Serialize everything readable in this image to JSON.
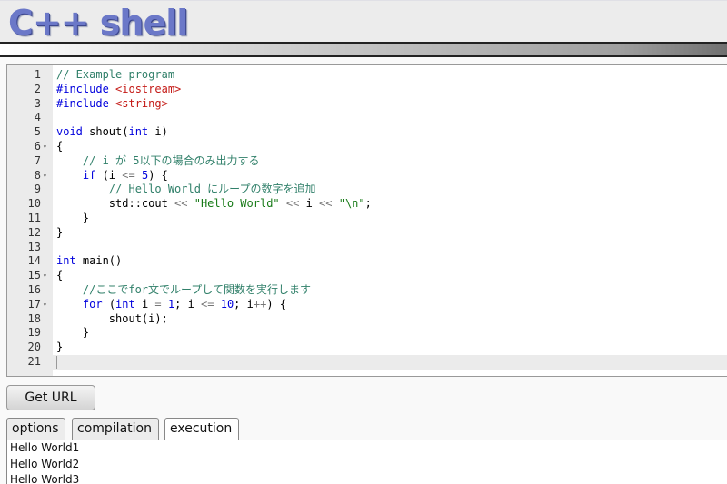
{
  "header": {
    "logo_text": "C++ shell"
  },
  "editor": {
    "lines": [
      {
        "n": "1",
        "fold": "",
        "html": "<span class='cm'>// Example program</span>"
      },
      {
        "n": "2",
        "fold": "",
        "html": "<span class='kw'>#include</span> <span class='inc'>&lt;iostream&gt;</span>"
      },
      {
        "n": "3",
        "fold": "",
        "html": "<span class='kw'>#include</span> <span class='inc'>&lt;string&gt;</span>"
      },
      {
        "n": "4",
        "fold": "",
        "html": ""
      },
      {
        "n": "5",
        "fold": "",
        "html": "<span class='kw'>void</span> shout(<span class='kw'>int</span> i)"
      },
      {
        "n": "6",
        "fold": "▾",
        "html": "{"
      },
      {
        "n": "7",
        "fold": "",
        "html": "    <span class='cm'>// i が 5以下の場合のみ出力する</span>"
      },
      {
        "n": "8",
        "fold": "▾",
        "html": "    <span class='kw'>if</span> (i <span class='op'>&lt;=</span> <span class='num'>5</span>) {"
      },
      {
        "n": "9",
        "fold": "",
        "html": "        <span class='cm'>// Hello World にループの数字を追加</span>"
      },
      {
        "n": "10",
        "fold": "",
        "html": "        std::cout <span class='op'>&lt;&lt;</span> <span class='str'>\"Hello World\"</span> <span class='op'>&lt;&lt;</span> i <span class='op'>&lt;&lt;</span> <span class='str'>\"\\n\"</span>;"
      },
      {
        "n": "11",
        "fold": "",
        "html": "    }"
      },
      {
        "n": "12",
        "fold": "",
        "html": "}"
      },
      {
        "n": "13",
        "fold": "",
        "html": ""
      },
      {
        "n": "14",
        "fold": "",
        "html": "<span class='kw'>int</span> main()"
      },
      {
        "n": "15",
        "fold": "▾",
        "html": "{"
      },
      {
        "n": "16",
        "fold": "",
        "html": "    <span class='cm'>//ここでfor文でループして関数を実行します</span>"
      },
      {
        "n": "17",
        "fold": "▾",
        "html": "    <span class='kw'>for</span> (<span class='kw'>int</span> i <span class='op'>=</span> <span class='num'>1</span>; i <span class='op'>&lt;=</span> <span class='num'>10</span>; i<span class='op'>++</span>) {"
      },
      {
        "n": "18",
        "fold": "",
        "html": "        shout(i);"
      },
      {
        "n": "19",
        "fold": "",
        "html": "    }"
      },
      {
        "n": "20",
        "fold": "",
        "html": "}"
      },
      {
        "n": "21",
        "fold": "",
        "html": "<span class='cursor'></span>",
        "active": true
      }
    ]
  },
  "toolbar": {
    "get_url_label": "Get URL"
  },
  "tabs": [
    {
      "label": "options",
      "active": false
    },
    {
      "label": "compilation",
      "active": false
    },
    {
      "label": "execution",
      "active": true
    }
  ],
  "output": {
    "lines": [
      "Hello World1",
      "Hello World2",
      "Hello World3"
    ]
  }
}
